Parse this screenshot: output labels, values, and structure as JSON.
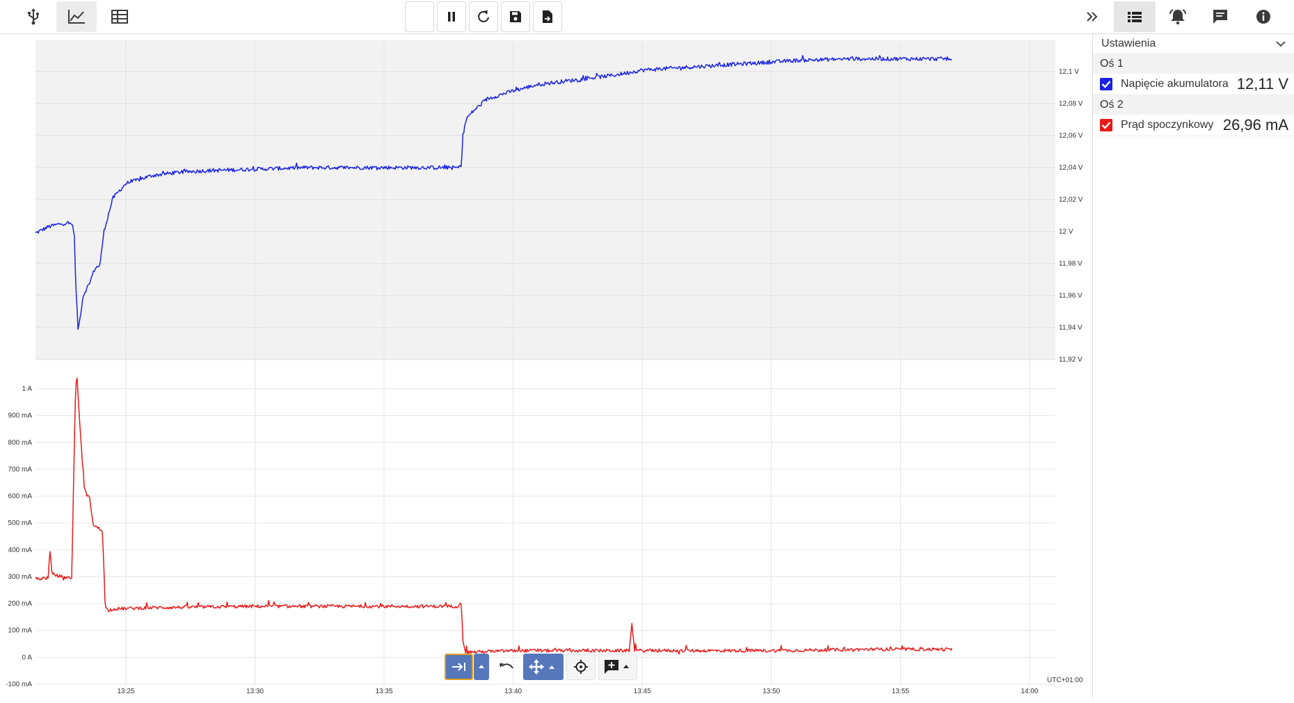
{
  "toolbar": {
    "left": [
      {
        "icon": "usb-icon",
        "active": false
      },
      {
        "icon": "line-chart-icon",
        "active": true
      },
      {
        "icon": "table-icon",
        "active": false
      }
    ],
    "center": [
      {
        "icon": "blank",
        "name": "empty-button"
      },
      {
        "icon": "pause-icon",
        "name": "pause-button"
      },
      {
        "icon": "refresh-icon",
        "name": "refresh-button"
      },
      {
        "icon": "save-icon",
        "name": "save-button"
      },
      {
        "icon": "export-file-icon",
        "name": "export-button"
      }
    ],
    "right": [
      {
        "icon": "double-chevron-right-icon",
        "active": false
      },
      {
        "icon": "list-icon",
        "active": true
      },
      {
        "icon": "alarm-icon",
        "active": false
      },
      {
        "icon": "comment-icon",
        "active": false
      },
      {
        "icon": "info-icon",
        "active": false
      }
    ]
  },
  "sidebar": {
    "title": "Ustawienia",
    "groups": [
      {
        "label": "Oś 1",
        "items": [
          {
            "label": "Napięcie akumulatora",
            "value": "12,11 V",
            "color": "#1a22e0",
            "checked": true
          }
        ]
      },
      {
        "label": "Oś 2",
        "items": [
          {
            "label": "Prąd spoczynkowy",
            "value": "26,96 mA",
            "color": "#e81818",
            "checked": true
          }
        ]
      }
    ]
  },
  "chart_data": [
    {
      "type": "line",
      "name": "Napięcie akumulatora",
      "color": "#1a22e0",
      "ylim": [
        11.92,
        12.12
      ],
      "yticks": [
        12.1,
        12.08,
        12.06,
        12.04,
        12.02,
        12.0,
        11.98,
        11.96,
        11.94,
        11.92
      ],
      "ytick_labels": [
        "12,1 V",
        "12,08 V",
        "12,06 V",
        "12,04 V",
        "12,02 V",
        "12 V",
        "11,98 V",
        "11,96 V",
        "11,94 V",
        "11,92 V"
      ],
      "x_minutes": [
        21.5,
        22.0,
        22.5,
        22.9,
        23.0,
        23.05,
        23.15,
        23.35,
        23.6,
        23.8,
        24.0,
        24.15,
        24.5,
        25.0,
        26.0,
        27.0,
        28.0,
        30.0,
        32.0,
        34.0,
        36.0,
        37.5,
        37.9,
        38.0,
        38.05,
        38.2,
        38.5,
        39.0,
        40.0,
        41.0,
        42.0,
        43.0,
        44.0,
        45.0,
        47.0,
        49.0,
        51.0,
        53.0,
        55.0,
        57.0
      ],
      "y": [
        11.999,
        12.003,
        12.005,
        12.005,
        12.0,
        11.97,
        11.938,
        11.96,
        11.968,
        11.977,
        11.979,
        12.0,
        12.021,
        12.03,
        12.035,
        12.037,
        12.038,
        12.039,
        12.04,
        12.04,
        12.04,
        12.04,
        12.04,
        12.042,
        12.06,
        12.071,
        12.076,
        12.083,
        12.088,
        12.092,
        12.094,
        12.096,
        12.098,
        12.101,
        12.103,
        12.105,
        12.107,
        12.108,
        12.108,
        12.108
      ]
    },
    {
      "type": "line",
      "name": "Prąd spoczynkowy",
      "color": "#e81818",
      "ylim": [
        -100,
        1050
      ],
      "yticks": [
        1000,
        900,
        800,
        700,
        600,
        500,
        400,
        300,
        200,
        100,
        0,
        -100
      ],
      "ytick_labels": [
        "1 A",
        "900 mA",
        "800 mA",
        "700 mA",
        "600 mA",
        "500 mA",
        "400 mA",
        "300 mA",
        "200 mA",
        "100 mA",
        "0 A",
        "-100 mA"
      ],
      "x_minutes": [
        21.5,
        21.8,
        22.0,
        22.05,
        22.15,
        22.5,
        22.9,
        23.05,
        23.1,
        23.25,
        23.4,
        23.6,
        23.75,
        23.95,
        24.1,
        24.2,
        24.3,
        24.5,
        26.0,
        30.0,
        34.0,
        37.8,
        38.0,
        38.05,
        38.15,
        38.5,
        40.0,
        44.5,
        44.6,
        44.7,
        46.0,
        50.0,
        54.0,
        57.0
      ],
      "y": [
        290,
        295,
        295,
        400,
        310,
        300,
        295,
        1000,
        1050,
        820,
        620,
        590,
        490,
        480,
        470,
        190,
        175,
        180,
        185,
        190,
        190,
        190,
        200,
        70,
        20,
        20,
        25,
        25,
        130,
        25,
        25,
        25,
        30,
        30
      ]
    }
  ],
  "x_axis": {
    "range_minutes": [
      21.5,
      61.0
    ],
    "ticks": [
      25,
      30,
      35,
      40,
      45,
      50,
      55,
      60
    ],
    "tick_labels": [
      "13:25",
      "13:30",
      "13:35",
      "13:40",
      "13:45",
      "13:50",
      "13:55",
      "14:00"
    ],
    "timezone": "UTC+01:00"
  },
  "chart_toolbar": [
    {
      "icon": "scroll-to-end-icon",
      "style": "blue"
    },
    {
      "icon": "caret-up-icon",
      "style": "blue"
    },
    {
      "icon": "undo-icon",
      "style": "plain"
    },
    {
      "icon": "move-icon",
      "style": "blue"
    },
    {
      "icon": "crosshair-icon",
      "style": "plain"
    },
    {
      "icon": "add-comment-icon",
      "style": "plain"
    }
  ]
}
